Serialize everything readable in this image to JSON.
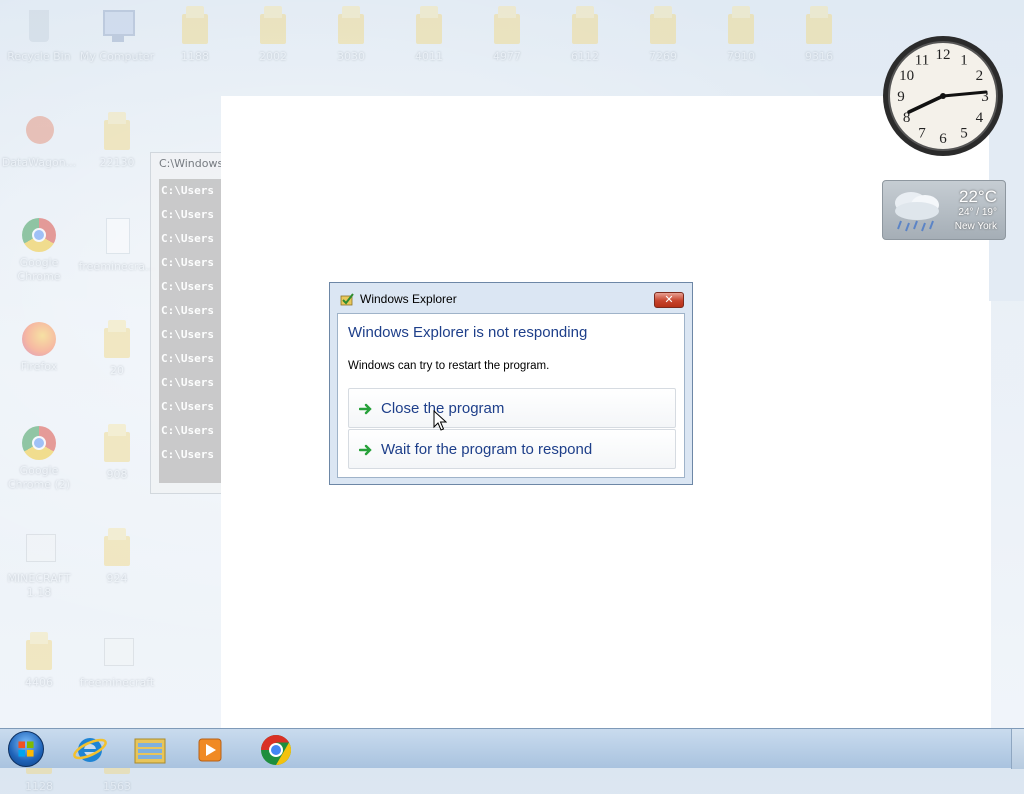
{
  "desktop": {
    "icons_top": [
      {
        "label": "Recycle Bin",
        "kind": "bin"
      },
      {
        "label": "My Computer",
        "kind": "computer"
      },
      {
        "label": "1188",
        "kind": "folder"
      },
      {
        "label": "2002",
        "kind": "folder"
      },
      {
        "label": "3030",
        "kind": "folder"
      },
      {
        "label": "4011",
        "kind": "folder"
      },
      {
        "label": "4977",
        "kind": "folder"
      },
      {
        "label": "6112",
        "kind": "folder"
      },
      {
        "label": "7269",
        "kind": "folder"
      },
      {
        "label": "7910",
        "kind": "folder"
      },
      {
        "label": "9316",
        "kind": "folder"
      }
    ],
    "icons_left": [
      {
        "label": "DataWagon...",
        "kind": "datawagon"
      },
      {
        "label": "22130",
        "kind": "folder"
      },
      {
        "label": "Google Chrome",
        "kind": "chrome"
      },
      {
        "label": "freeminecra...",
        "kind": "file"
      },
      {
        "label": "Firefox",
        "kind": "firefox"
      },
      {
        "label": "20",
        "kind": "folder"
      },
      {
        "label": "Google Chrome (2)",
        "kind": "chrome"
      },
      {
        "label": "908",
        "kind": "folder"
      },
      {
        "label": "MINECRAFT 1.18",
        "kind": "pc"
      },
      {
        "label": "924",
        "kind": "folder"
      },
      {
        "label": "4406",
        "kind": "folder"
      },
      {
        "label": "freeminecraft",
        "kind": "pc"
      },
      {
        "label": "1128",
        "kind": "folder"
      },
      {
        "label": "1563",
        "kind": "folder"
      }
    ]
  },
  "cmd_window": {
    "title": "C:\\Windows",
    "lines": [
      "C:\\Users",
      "C:\\Users",
      "C:\\Users",
      "C:\\Users",
      "C:\\Users",
      "C:\\Users",
      "C:\\Users",
      "C:\\Users",
      "C:\\Users",
      "C:\\Users",
      "C:\\Users",
      "C:\\Users"
    ]
  },
  "dialog": {
    "title": "Windows Explorer",
    "close_glyph": "✕",
    "heading": "Windows Explorer is not responding",
    "message": "Windows can try to restart the program.",
    "option_close": "Close the program",
    "option_wait": "Wait for the program to respond"
  },
  "gadgets": {
    "clock": {
      "hour_numbers": [
        "12",
        "1",
        "2",
        "3",
        "4",
        "5",
        "6",
        "7",
        "8",
        "9",
        "10",
        "11"
      ]
    },
    "weather": {
      "temp": "22°C",
      "range": "24° / 19°",
      "city": "New York",
      "icon": "rain-cloud-icon"
    }
  },
  "taskbar": {
    "items": [
      {
        "name": "start-button",
        "icon": "windows-orb-icon"
      },
      {
        "name": "internet-explorer-button",
        "icon": "internet-explorer-icon"
      },
      {
        "name": "file-explorer-button",
        "icon": "folder-icon"
      },
      {
        "name": "media-player-button",
        "icon": "media-player-icon"
      },
      {
        "name": "chrome-button",
        "icon": "chrome-icon"
      }
    ]
  },
  "colors": {
    "dialog_heading": "#1e3f8a",
    "close_button": "#c7432c",
    "taskbar": "#b7cde5"
  }
}
